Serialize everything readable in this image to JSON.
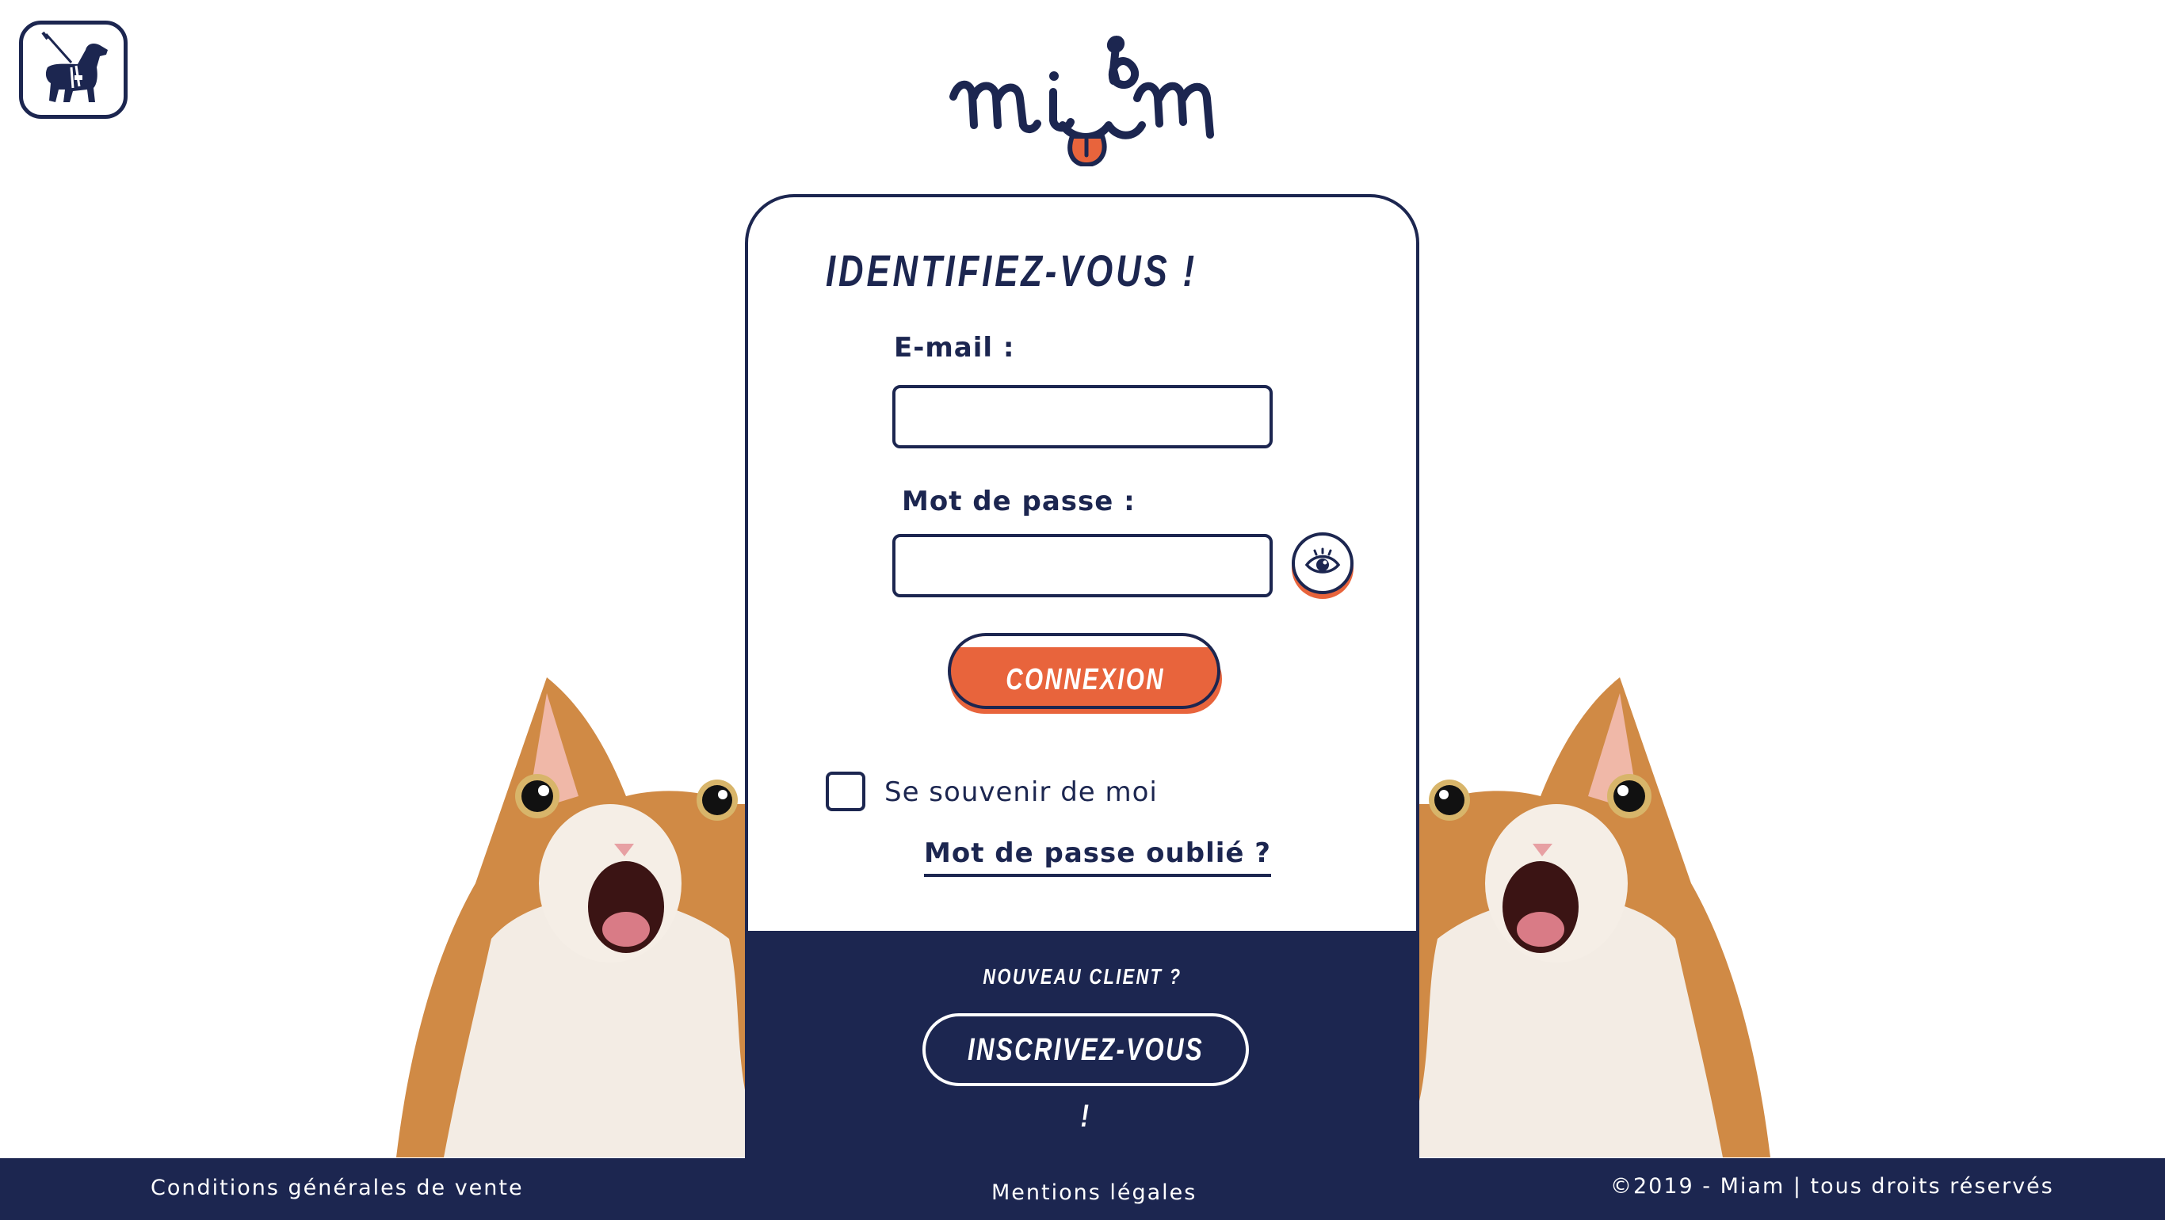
{
  "header": {
    "accessibility_icon": "guide-dog-icon",
    "logo_text": "miam"
  },
  "login_card": {
    "title": "IDENTIFIEZ-VOUS !",
    "email_label": "E-mail :",
    "email_value": "",
    "password_label": "Mot de passe :",
    "password_value": "",
    "show_password_icon": "eye-icon",
    "connect_button": "CONNEXION",
    "remember_label": "Se souvenir de moi",
    "remember_checked": false,
    "forgot_password": "Mot de passe oublié ?"
  },
  "signup_panel": {
    "prompt": "NOUVEAU CLIENT ?",
    "button": "INSCRIVEZ-VOUS !"
  },
  "footer": {
    "cgv": "Conditions générales de vente",
    "legal": "Mentions légales",
    "copyright": "©2019 - Miam | tous droits réservés"
  },
  "colors": {
    "navy": "#1c2650",
    "accent": "#e8643c",
    "background": "#ffffff"
  }
}
